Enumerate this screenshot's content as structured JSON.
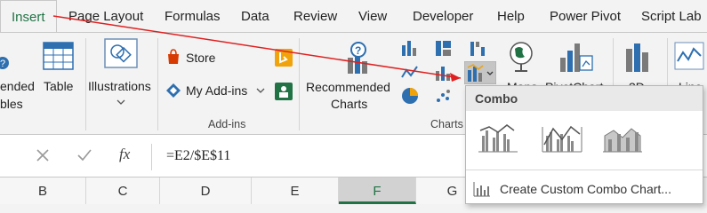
{
  "tabs": [
    "Insert",
    "Page Layout",
    "Formulas",
    "Data",
    "Review",
    "View",
    "Developer",
    "Help",
    "Power Pivot",
    "Script Lab"
  ],
  "ribbon": {
    "pivot_label_1": "ended",
    "pivot_label_2": "bles",
    "table_label": "Table",
    "illustrations_label": "Illustrations",
    "store_label": "Store",
    "my_addins_label": "My Add-ins",
    "addins_group": "Add-ins",
    "recommended_charts_1": "Recommended",
    "recommended_charts_2": "Charts",
    "charts_group": "Charts",
    "maps_label": "Maps",
    "pivotchart_label": "PivotChart",
    "threed_label": "3D",
    "line_label": "Line"
  },
  "formula_bar": {
    "fx": "fx",
    "value": "=E2/$E$11"
  },
  "columns": [
    "B",
    "C",
    "D",
    "E",
    "F",
    "G"
  ],
  "selected_column": "F",
  "combo_menu": {
    "header": "Combo",
    "options": [
      "Clustered Column - Line",
      "Clustered Column - Line on Secondary Axis",
      "Stacked Area - Clustered Column"
    ],
    "custom_label": "Create Custom Combo Chart..."
  },
  "colors": {
    "accent": "#217346",
    "arrow": "#e02020"
  }
}
